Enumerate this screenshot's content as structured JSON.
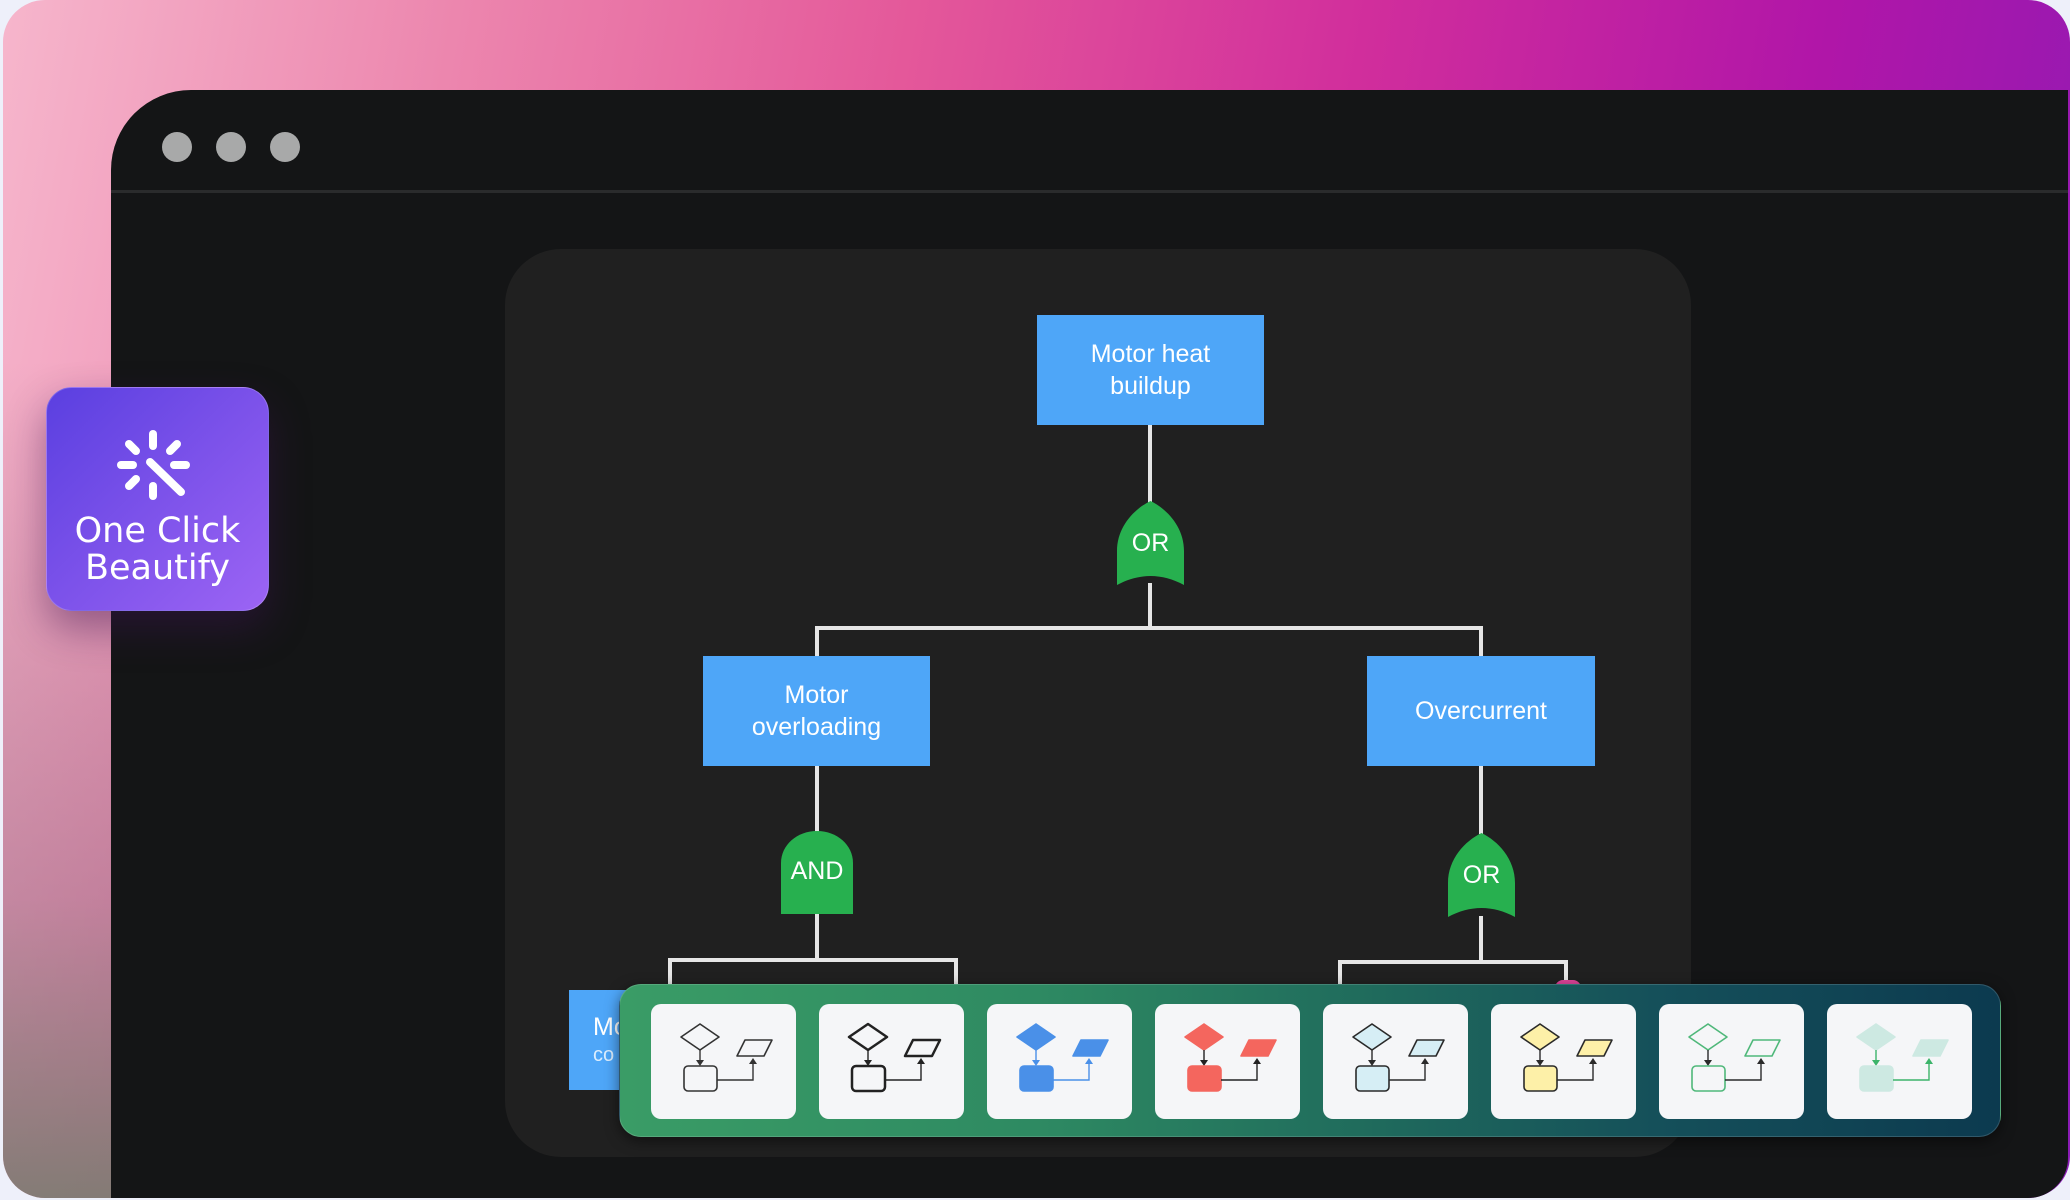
{
  "window": {
    "controls": [
      "window-dot-1",
      "window-dot-2",
      "window-dot-3"
    ]
  },
  "feature_button": {
    "label_line1": "One Click",
    "label_line2": "Beautify",
    "icon": "magic-wand-icon"
  },
  "diagram": {
    "type": "fault-tree",
    "nodes": {
      "root": "Motor heat buildup",
      "left": "Motor overloading",
      "right": "Overcurrent",
      "partial_bottom_left_line1": "Mo",
      "partial_bottom_left_line2": "co"
    },
    "gates": {
      "root_gate": "OR",
      "left_gate": "AND",
      "right_gate": "OR"
    },
    "colors": {
      "node": "#4ea6f8",
      "gate": "#27b04f",
      "connector": "#e6e6e6",
      "hidden_node_accent": "#e0449a"
    }
  },
  "style_toolbar": {
    "styles": [
      {
        "name": "thin-outline",
        "fill": "none",
        "stroke": "#333333",
        "arrow": "#333333"
      },
      {
        "name": "bold-outline",
        "fill": "none",
        "stroke": "#222222",
        "arrow": "#222222"
      },
      {
        "name": "blue-filled",
        "fill": "#4a90e8",
        "stroke": "#4a90e8",
        "arrow": "#4a90e8"
      },
      {
        "name": "red-filled",
        "fill": "#f4665e",
        "stroke": "#f4665e",
        "arrow": "#222222"
      },
      {
        "name": "light-blue",
        "fill": "#d6eef5",
        "stroke": "#2a2a2a",
        "arrow": "#2a2a2a"
      },
      {
        "name": "yellow",
        "fill": "#fdf0a8",
        "stroke": "#2a2a2a",
        "arrow": "#2a2a2a"
      },
      {
        "name": "green-outline",
        "fill": "none",
        "stroke": "#4fb87a",
        "arrow": "#2a2a2a"
      },
      {
        "name": "mint-filled",
        "fill": "#cde9e2",
        "stroke": "#cde9e2",
        "arrow": "#3cb46a"
      }
    ]
  }
}
